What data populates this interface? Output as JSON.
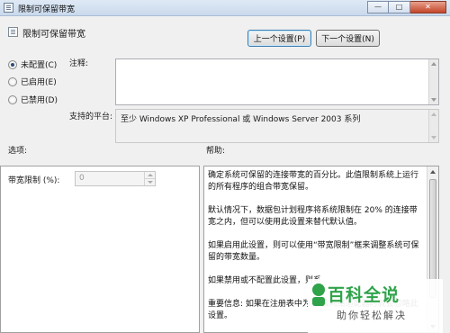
{
  "window": {
    "title": "限制可保留带宽",
    "controls": {
      "minimize": "—",
      "maximize": "□",
      "close": "✕"
    }
  },
  "header": {
    "title": "限制可保留带宽"
  },
  "nav": {
    "prev_label": "上一个设置(P)",
    "next_label": "下一个设置(N)"
  },
  "state": {
    "options": [
      {
        "label": "未配置(C)",
        "checked": true
      },
      {
        "label": "已启用(E)",
        "checked": false
      },
      {
        "label": "已禁用(D)",
        "checked": false
      }
    ]
  },
  "comment": {
    "label": "注释:",
    "value": ""
  },
  "platform": {
    "label": "支持的平台:",
    "value": "至少 Windows XP Professional 或 Windows Server 2003 系列"
  },
  "sections": {
    "options_label": "选项:",
    "help_label": "帮助:"
  },
  "options_pane": {
    "limit_label": "带宽限制 (%):",
    "limit_value": "0"
  },
  "help": {
    "paragraphs": [
      "确定系统可保留的连接带宽的百分比。此值限制系统上运行的所有程序的组合带宽保留。",
      "默认情况下，数据包计划程序将系统限制在 20% 的连接带宽之内，但可以使用此设置来替代默认值。",
      "如果启用此设置，则可以使用“带宽限制”框来调整系统可保留的带宽数量。",
      "如果禁用或不配置此设置，则系",
      "重要信息: 如果在注册表中为特 该网络适配器时就会忽略此设置。"
    ]
  },
  "watermark": {
    "title": "百科全说",
    "subtitle": "助你轻松解决"
  }
}
